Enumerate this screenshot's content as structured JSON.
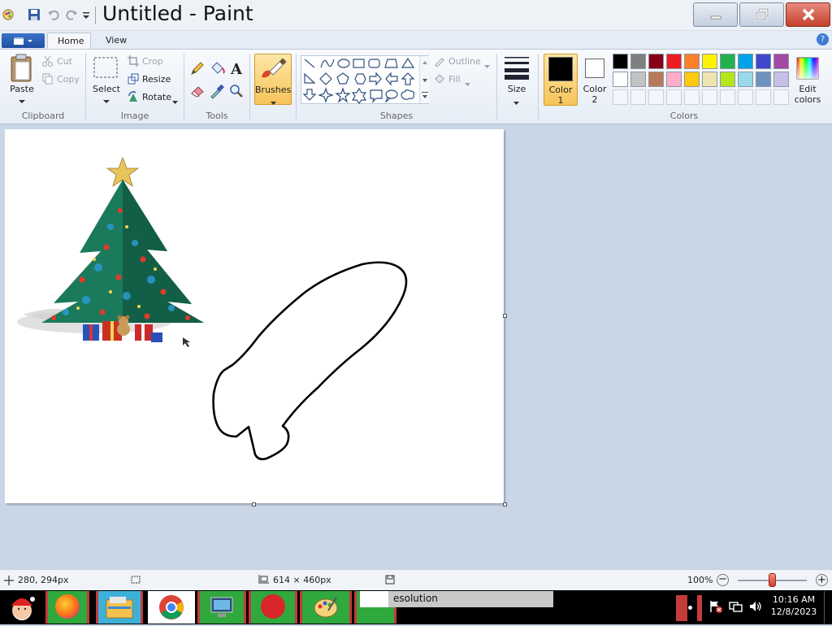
{
  "window": {
    "title": "Untitled - Paint"
  },
  "tabs": [
    {
      "label": "Home",
      "active": true
    },
    {
      "label": "View",
      "active": false
    }
  ],
  "ribbon": {
    "clipboard": {
      "group_label": "Clipboard",
      "paste_label": "Paste",
      "cut_label": "Cut",
      "copy_label": "Copy"
    },
    "image": {
      "group_label": "Image",
      "select_label": "Select",
      "crop_label": "Crop",
      "resize_label": "Resize",
      "rotate_label": "Rotate"
    },
    "tools": {
      "group_label": "Tools"
    },
    "brushes": {
      "label": "Brushes"
    },
    "shapes": {
      "group_label": "Shapes",
      "outline_label": "Outline",
      "fill_label": "Fill"
    },
    "size": {
      "label": "Size"
    },
    "colors": {
      "group_label": "Colors",
      "color1_line1": "Color",
      "color1_line2": "1",
      "color2_line1": "Color",
      "color2_line2": "2",
      "edit_line1": "Edit",
      "edit_line2": "colors",
      "color1_value": "#000000",
      "color2_value": "#ffffff",
      "palette_row1": [
        "#000000",
        "#7f7f7f",
        "#880015",
        "#ed1c24",
        "#ff7f27",
        "#fff200",
        "#22b14c",
        "#00a2e8",
        "#3f48cc",
        "#a349a4"
      ],
      "palette_row2": [
        "#ffffff",
        "#c3c3c3",
        "#b97a57",
        "#ffaec9",
        "#ffc90e",
        "#efe4b0",
        "#b5e61d",
        "#99d9ea",
        "#7092be",
        "#c8bfe7"
      ]
    }
  },
  "status": {
    "cursor_pos": "280, 294px",
    "canvas_size": "614 × 460px",
    "zoom": "100%",
    "zoom_level": 1.0
  },
  "taskbar": {
    "search_text": "esolution",
    "time": "10:16 AM",
    "date": "12/8/2023"
  }
}
